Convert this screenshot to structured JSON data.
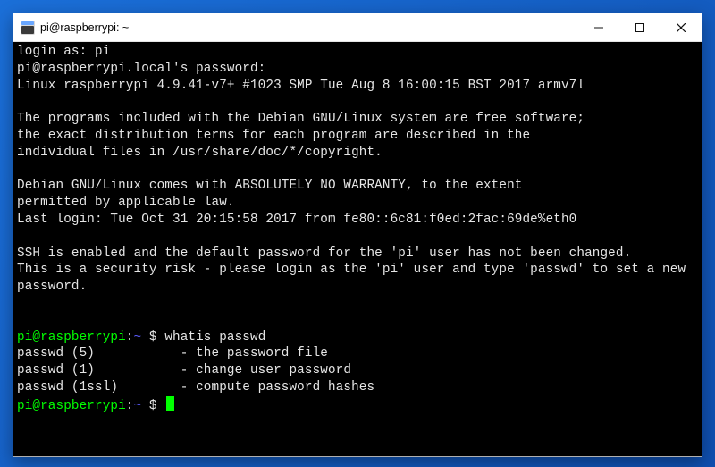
{
  "window": {
    "title": "pi@raspberrypi: ~"
  },
  "motd": {
    "login_as": "login as: pi",
    "password_prompt": "pi@raspberrypi.local's password:",
    "kernel": "Linux raspberrypi 4.9.41-v7+ #1023 SMP Tue Aug 8 16:00:15 BST 2017 armv7l",
    "debian_free_1": "The programs included with the Debian GNU/Linux system are free software;",
    "debian_free_2": "the exact distribution terms for each program are described in the",
    "debian_free_3": "individual files in /usr/share/doc/*/copyright.",
    "warranty_1": "Debian GNU/Linux comes with ABSOLUTELY NO WARRANTY, to the extent",
    "warranty_2": "permitted by applicable law.",
    "last_login": "Last login: Tue Oct 31 20:15:58 2017 from fe80::6c81:f0ed:2fac:69de%eth0",
    "ssh_warn_1": "SSH is enabled and the default password for the 'pi' user has not been changed.",
    "ssh_warn_2": "This is a security risk - please login as the 'pi' user and type 'passwd' to set a new password."
  },
  "prompt": {
    "userhost": "pi@raspberrypi",
    "colon": ":",
    "path": "~",
    "dollar": " $ "
  },
  "session": {
    "cmd1": "whatis passwd",
    "out1": "passwd (5)           - the password file",
    "out2": "passwd (1)           - change user password",
    "out3": "passwd (1ssl)        - compute password hashes"
  },
  "icons": {
    "app": "terminal-icon",
    "minimize": "minimize-icon",
    "maximize": "maximize-icon",
    "close": "close-icon"
  }
}
